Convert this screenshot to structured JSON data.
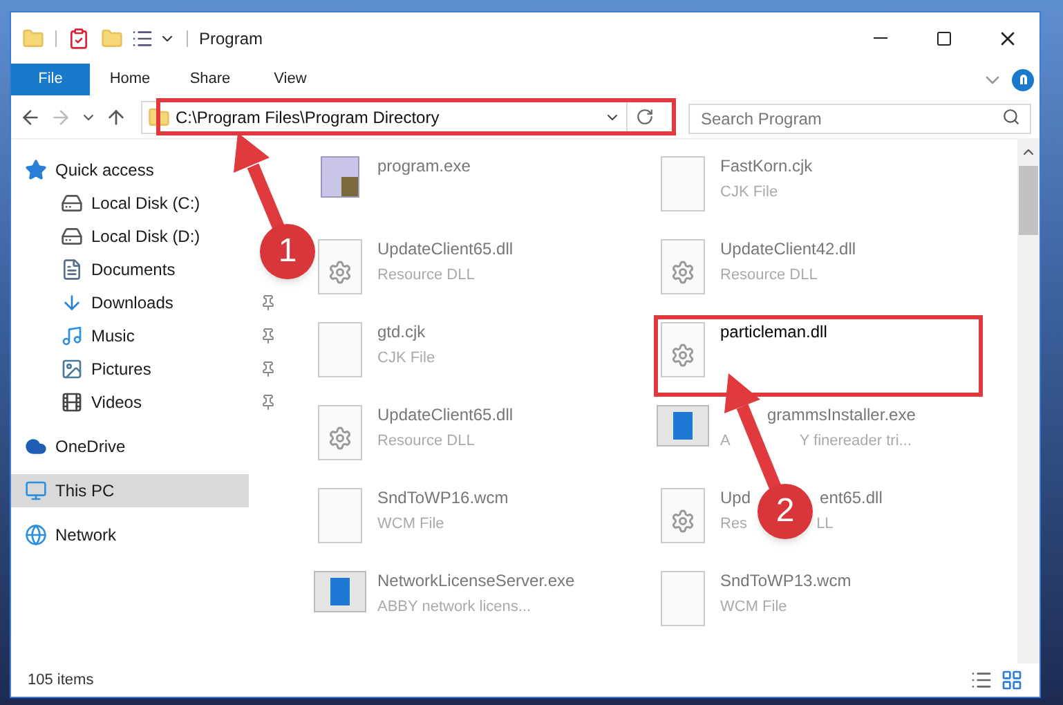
{
  "window": {
    "title": "Program"
  },
  "ribbon_tabs": [
    {
      "label": "File",
      "selected": true
    },
    {
      "label": "Home",
      "selected": false
    },
    {
      "label": "Share",
      "selected": false
    },
    {
      "label": "View",
      "selected": false
    }
  ],
  "address": {
    "path": "C:\\Program Files\\Program Directory"
  },
  "search": {
    "placeholder": "Search Program"
  },
  "sidebar": {
    "items": [
      {
        "label": "Quick access",
        "kind": "star",
        "selected": false,
        "children": [
          {
            "label": "Local Disk (C:)",
            "kind": "disk",
            "selected": false,
            "pinned": false
          },
          {
            "label": "Local Disk (D:)",
            "kind": "disk",
            "selected": false,
            "pinned": false
          },
          {
            "label": "Documents",
            "kind": "documents",
            "selected": false,
            "pinned": false
          },
          {
            "label": "Downloads",
            "kind": "downloads",
            "selected": false,
            "pinned": true
          },
          {
            "label": "Music",
            "kind": "music",
            "selected": false,
            "pinned": true
          },
          {
            "label": "Pictures",
            "kind": "pictures",
            "selected": false,
            "pinned": true
          },
          {
            "label": "Videos",
            "kind": "videos",
            "selected": false,
            "pinned": true
          }
        ]
      },
      {
        "label": "OneDrive",
        "kind": "cloud",
        "selected": false
      },
      {
        "label": "This PC",
        "kind": "pc",
        "selected": true
      },
      {
        "label": "Network",
        "kind": "network",
        "selected": false
      }
    ]
  },
  "files": [
    {
      "name_parts": [
        "program.exe"
      ],
      "kind": "exe",
      "selected": false
    },
    {
      "name_parts": [
        "FastKorn.cjk"
      ],
      "type_parts": [
        "CJK File"
      ],
      "kind": "blank",
      "selected": false
    },
    {
      "name_parts": [
        "UpdateClient65.dll"
      ],
      "type_parts": [
        "Resource DLL"
      ],
      "kind": "dll",
      "selected": false
    },
    {
      "name_parts": [
        "UpdateClient42.dll"
      ],
      "type_parts": [
        "Resource DLL"
      ],
      "kind": "dll",
      "selected": false
    },
    {
      "name_parts": [
        "gtd.cjk"
      ],
      "type_parts": [
        "CJK File"
      ],
      "kind": "blank",
      "selected": false
    },
    {
      "name_parts": [
        "particleman.dll"
      ],
      "kind": "dll",
      "selected": true
    },
    {
      "name_parts": [
        "UpdateClient65.dll"
      ],
      "type_parts": [
        "Resource DLL"
      ],
      "kind": "dll",
      "selected": false
    },
    {
      "name_parts": [
        "grammsInstaller.exe"
      ],
      "type_parts": [
        "A",
        "Y finereader tri..."
      ],
      "kind": "app",
      "selected": false
    },
    {
      "name_parts": [
        "SndToWP16.wcm"
      ],
      "type_parts": [
        "WCM File"
      ],
      "kind": "blank",
      "selected": false
    },
    {
      "name_parts": [
        "Upd",
        "ent65.dll"
      ],
      "type_parts": [
        "Res",
        "LL"
      ],
      "kind": "dll",
      "selected": false
    },
    {
      "name_parts": [
        "NetworkLicenseServer.exe"
      ],
      "type_parts": [
        "ABBY network licens..."
      ],
      "kind": "app",
      "selected": false
    },
    {
      "name_parts": [
        "SndToWP13.wcm"
      ],
      "type_parts": [
        "WCM File"
      ],
      "kind": "blank",
      "selected": false
    }
  ],
  "status_bar": {
    "count": "105 items"
  },
  "annotations": [
    {
      "number": "1"
    },
    {
      "number": "2"
    }
  ]
}
